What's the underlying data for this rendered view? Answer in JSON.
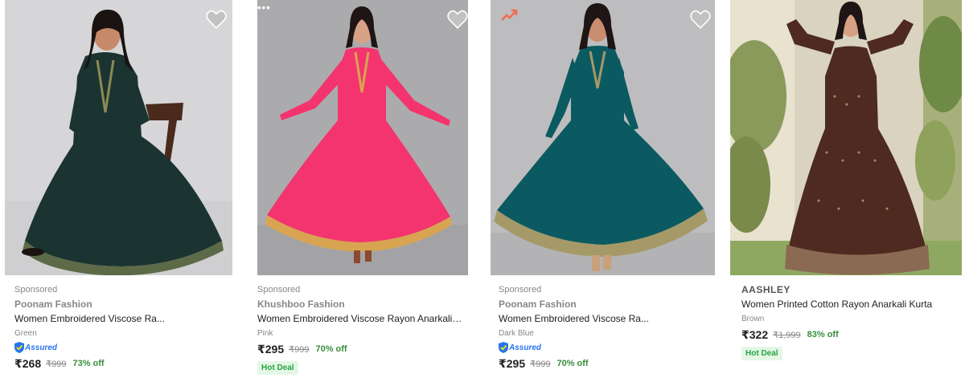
{
  "products": [
    {
      "sponsored": "Sponsored",
      "brand": "Poonam Fashion",
      "title": "Women Embroidered Viscose Ra...",
      "color": "Green",
      "assured": "Assured",
      "price": "₹268",
      "mrp": "₹999",
      "discount": "73% off",
      "dress_color": "#1b3431",
      "bg_color": "#d6d6d8"
    },
    {
      "sponsored": "Sponsored",
      "brand": "Khushboo Fashion",
      "title": "Women Embroidered Viscose Rayon Anarkali ...",
      "color": "Pink",
      "price": "₹295",
      "mrp": "₹999",
      "discount": "70% off",
      "hot_deal": "Hot Deal",
      "dress_color": "#f4346e",
      "bg_color": "#ababae"
    },
    {
      "sponsored": "Sponsored",
      "brand": "Poonam Fashion",
      "title": "Women Embroidered Viscose Ra...",
      "color": "Dark Blue",
      "assured": "Assured",
      "price": "₹295",
      "mrp": "₹999",
      "discount": "70% off",
      "dress_color": "#0c5a61",
      "bg_color": "#bdbdbf"
    },
    {
      "brand": "AASHLEY",
      "title": "Women Printed Cotton Rayon Anarkali Kurta",
      "color": "Brown",
      "price": "₹322",
      "mrp": "₹1,999",
      "discount": "83% off",
      "hot_deal": "Hot Deal",
      "dress_color": "#4e2a20",
      "bg_color": "#d9d3c0"
    }
  ],
  "colors": {
    "accent_blue": "#2874f0",
    "discount_green": "#388e3c",
    "hot_deal_bg": "#e4f7e6",
    "muted_text": "#878787"
  },
  "icons": [
    "wishlist-heart-icon",
    "more-options-icon",
    "trending-icon",
    "assured-shield-icon"
  ]
}
